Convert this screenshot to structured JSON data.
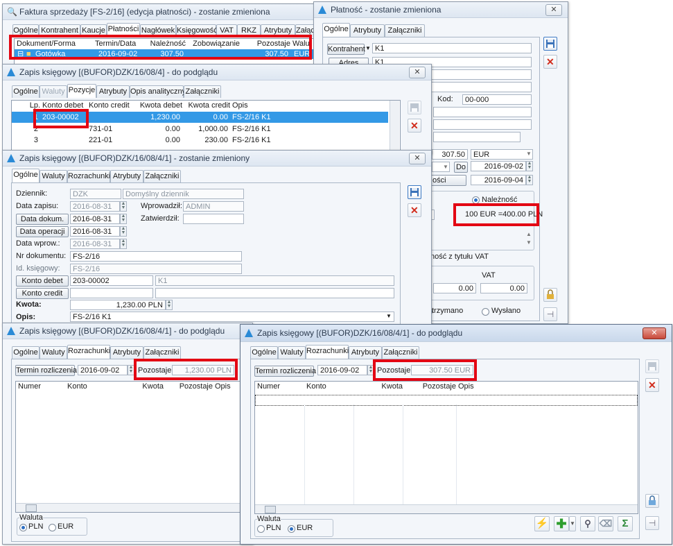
{
  "w1": {
    "title": "Faktura sprzedaży [FS-2/16] (edycja płatności) - zostanie zmieniona",
    "tabs": [
      "Ogólne",
      "Kontrahent",
      "Kaucje",
      "Płatności",
      "Nagłówek",
      "Księgowość",
      "VAT",
      "RKZ",
      "Atrybuty",
      "Załączniki"
    ],
    "cols": [
      "Dokument/Forma",
      "Termin/Data",
      "Należność",
      "Zobowiązanie",
      "Pozostaje",
      "Walut"
    ],
    "row": {
      "forma": "Gotówka",
      "data": "2016-09-02",
      "naleznosc": "307.50",
      "pozostaje": "307.50",
      "waluta": "EUR"
    }
  },
  "w2": {
    "title": "Płatność - zostanie zmieniona",
    "tabs": [
      "Ogólne",
      "Atrybuty",
      "Załączniki"
    ],
    "kontrahent_btn": "Kontrahent",
    "kontrahent_val": "K1",
    "adres_btn": "Adres",
    "adres_val": "K1",
    "kod_label": "Kod:",
    "kod_val": "00-000",
    "kwota": "307.50",
    "waluta": "EUR",
    "do_btn": "Do",
    "data1": "2016-09-02",
    "data2": "2016-09-04",
    "btn_partial": "ości",
    "naleznosc_label": "Należność",
    "amount_line": "100 EUR  =400.00 PLN",
    "vat_text": "ność z tytułu VAT",
    "vat_label": "VAT",
    "vat_val1": "0.00",
    "vat_val2": "0.00",
    "otrzymano": "trzymano",
    "wyslano": "Wysłano"
  },
  "w3": {
    "title": "Zapis księgowy [(BUFOR)DZK/16/08/4] - do podglądu",
    "tabs": [
      "Ogólne",
      "Waluty",
      "Pozycje",
      "Atrybuty",
      "Opis analityczny",
      "Załączniki"
    ],
    "cols": [
      "Lp.",
      "Konto debet",
      "Konto credit",
      "Kwota debet",
      "Kwota credit",
      "Opis"
    ],
    "rows": [
      {
        "lp": "1",
        "debet": "203-00002",
        "credit": "",
        "kdebet": "1,230.00",
        "kcredit": "0.00",
        "opis": "FS-2/16 K1"
      },
      {
        "lp": "2",
        "debet": "",
        "credit": "731-01",
        "kdebet": "0.00",
        "kcredit": "1,000.00",
        "opis": "FS-2/16 K1"
      },
      {
        "lp": "3",
        "debet": "",
        "credit": "221-01",
        "kdebet": "0.00",
        "kcredit": "230.00",
        "opis": "FS-2/16 K1"
      }
    ]
  },
  "w4": {
    "title": "Zapis księgowy [(BUFOR)DZK/16/08/4/1] - zostanie zmieniony",
    "tabs": [
      "Ogólne",
      "Waluty",
      "Rozrachunki",
      "Atrybuty",
      "Załączniki"
    ],
    "dziennik_label": "Dziennik:",
    "dziennik_code": "DZK",
    "dziennik_name": "Domyślny dziennik",
    "data_zapisu_label": "Data zapisu:",
    "data_zapisu": "2016-08-31",
    "wprowadzil_label": "Wprowadził:",
    "wprowadzil": "ADMIN",
    "data_dokum_btn": "Data dokum.",
    "data_dokum": "2016-08-31",
    "zatwierdzil_label": "Zatwierdził:",
    "data_operacji_btn": "Data operacji",
    "data_operacji": "2016-08-31",
    "data_wprow_label": "Data wprow.:",
    "data_wprow": "2016-08-31",
    "nr_dok_label": "Nr dokumentu:",
    "nr_dok": "FS-2/16",
    "id_ksieg_label": "Id. księgowy:",
    "id_ksieg": "FS-2/16",
    "konto_debet_btn": "Konto debet",
    "konto_debet": "203-00002",
    "konto_debet_name": "K1",
    "konto_credit_btn": "Konto credit",
    "kwota_label": "Kwota:",
    "kwota": "1,230.00 PLN",
    "opis_label": "Opis:",
    "opis": "FS-2/16 K1"
  },
  "w5": {
    "title": "Zapis księgowy [(BUFOR)DZK/16/08/4/1] - do podglądu",
    "tabs": [
      "Ogólne",
      "Waluty",
      "Rozrachunki",
      "Atrybuty",
      "Załączniki"
    ],
    "termin_btn": "Termin rozliczenia",
    "data": "2016-09-02",
    "pozostaje_label": "Pozostaje:",
    "pozostaje": "1,230.00 PLN",
    "cols": [
      "Numer",
      "Konto",
      "Kwota",
      "Pozostaje",
      "Opis"
    ],
    "waluta_label": "Waluta",
    "radio1": "PLN",
    "radio2": "EUR"
  },
  "w6": {
    "title": "Zapis księgowy [(BUFOR)DZK/16/08/4/1] - do podglądu",
    "tabs": [
      "Ogólne",
      "Waluty",
      "Rozrachunki",
      "Atrybuty",
      "Załączniki"
    ],
    "termin_btn": "Termin rozliczenia",
    "data": "2016-09-02",
    "pozostaje_label": "Pozostaje:",
    "pozostaje": "307.50 EUR",
    "cols": [
      "Numer",
      "Konto",
      "Kwota",
      "Pozostaje",
      "Opis"
    ],
    "waluta_label": "Waluta",
    "radio1": "PLN",
    "radio2": "EUR"
  },
  "colors": {
    "highlight": "#e30613",
    "selection": "#3399e6"
  }
}
